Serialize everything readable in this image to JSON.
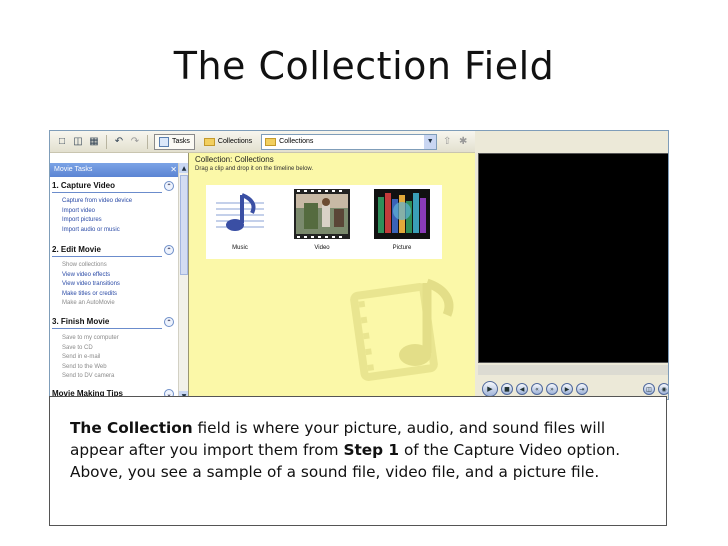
{
  "slide": {
    "title": "The Collection Field"
  },
  "toolbar": {
    "tasks_label": "Tasks",
    "collections_label": "Collections",
    "combo_value": "Collections"
  },
  "taskpane": {
    "header": "Movie Tasks",
    "sections": [
      {
        "title": "1. Capture Video",
        "links": [
          "Capture from video device",
          "Import video",
          "Import pictures",
          "Import audio or music"
        ]
      },
      {
        "title": "2. Edit Movie",
        "links": [
          "Show collections",
          "View video effects",
          "View video transitions",
          "Make titles or credits",
          "Make an AutoMovie"
        ]
      },
      {
        "title": "3. Finish Movie",
        "links": [
          "Save to my computer",
          "Save to CD",
          "Send in e-mail",
          "Send to the Web",
          "Send to DV camera"
        ]
      },
      {
        "title": "Movie Making Tips",
        "links": []
      }
    ]
  },
  "collection": {
    "title": "Collection: Collections",
    "subtitle": "Drag a clip and drop it on the timeline below.",
    "items": [
      {
        "caption": "Music",
        "icon": "music-note-icon"
      },
      {
        "caption": "Video",
        "icon": "video-clip-icon"
      },
      {
        "caption": "Picture",
        "icon": "picture-icon"
      }
    ]
  },
  "caption": {
    "bold1": "The Collection",
    "text1": " field is where your picture, audio, and sound files will appear after you import them from ",
    "bold2": "Step 1",
    "text2": " of the Capture Video option.  Above, you see a sample of a sound file, video file, and a picture file."
  },
  "colors": {
    "collection_bg": "#fbf8a8",
    "header_blue": "#5b84d3",
    "link_blue": "#2a4aa6"
  }
}
